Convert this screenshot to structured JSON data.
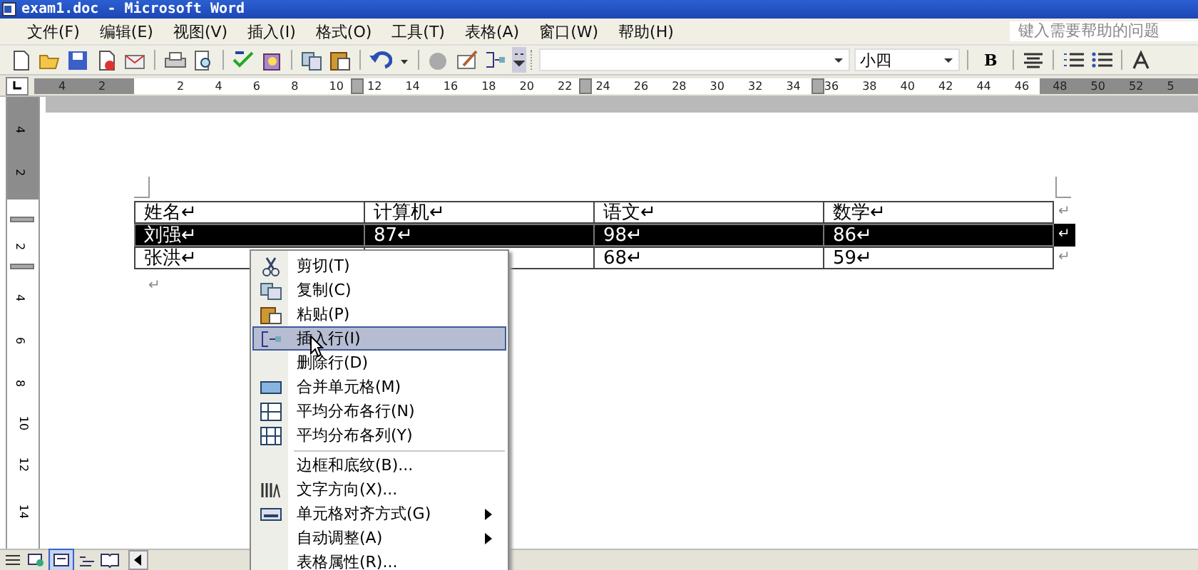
{
  "window": {
    "title": "exam1.doc - Microsoft Word"
  },
  "menu_bar": {
    "items": [
      "文件(F)",
      "编辑(E)",
      "视图(V)",
      "插入(I)",
      "格式(O)",
      "工具(T)",
      "表格(A)",
      "窗口(W)",
      "帮助(H)"
    ],
    "help_box": {
      "placeholder": "键入需要帮助的问题"
    }
  },
  "toolbar": {
    "font_size": "小四",
    "bold_label": "B"
  },
  "ruler": {
    "labels": [
      "4",
      "2",
      "2",
      "4",
      "6",
      "8",
      "10",
      "12",
      "14",
      "16",
      "18",
      "20",
      "22",
      "24",
      "26",
      "28",
      "30",
      "32",
      "34",
      "36",
      "38",
      "40",
      "42",
      "44",
      "46",
      "48",
      "50",
      "52",
      "5"
    ]
  },
  "vertical_ruler": {
    "labels": [
      "4",
      "2",
      "2",
      "4",
      "6",
      "8",
      "10",
      "12",
      "14"
    ]
  },
  "table": {
    "rows": [
      {
        "selected": false,
        "cells": [
          "姓名↵",
          "计算机↵",
          "语文↵",
          "数学↵"
        ],
        "end_mark": "↵"
      },
      {
        "selected": true,
        "cells": [
          "刘强↵",
          "87↵",
          "98↵",
          "86↵"
        ],
        "end_mark": "↵"
      },
      {
        "selected": false,
        "cells": [
          "张洪↵",
          null,
          "68↵",
          "59↵"
        ],
        "end_mark": "↵"
      }
    ],
    "after_mark": "↵"
  },
  "context_menu": {
    "items": [
      {
        "kind": "cut",
        "label": "剪切(T)",
        "selected": false
      },
      {
        "kind": "copy",
        "label": "复制(C)",
        "selected": false
      },
      {
        "kind": "paste",
        "label": "粘贴(P)",
        "selected": false
      },
      {
        "kind": "insert-row",
        "label": "插入行(I)",
        "selected": true
      },
      {
        "kind": "plain",
        "label": "删除行(D)",
        "selected": false
      },
      {
        "kind": "merge",
        "label": "合并单元格(M)",
        "selected": false
      },
      {
        "kind": "rows",
        "label": "平均分布各行(N)",
        "selected": false
      },
      {
        "kind": "cols",
        "label": "平均分布各列(Y)",
        "selected": false
      },
      {
        "kind": "plain",
        "label": "边框和底纹(B)...",
        "selected": false,
        "separator_before": true
      },
      {
        "kind": "direction",
        "label": "文字方向(X)...",
        "selected": false
      },
      {
        "kind": "align",
        "label": "单元格对齐方式(G)",
        "selected": false,
        "submenu": true
      },
      {
        "kind": "plain",
        "label": "自动调整(A)",
        "selected": false,
        "submenu": true
      },
      {
        "kind": "plain",
        "label": "表格属性(R)...",
        "selected": false
      }
    ]
  }
}
